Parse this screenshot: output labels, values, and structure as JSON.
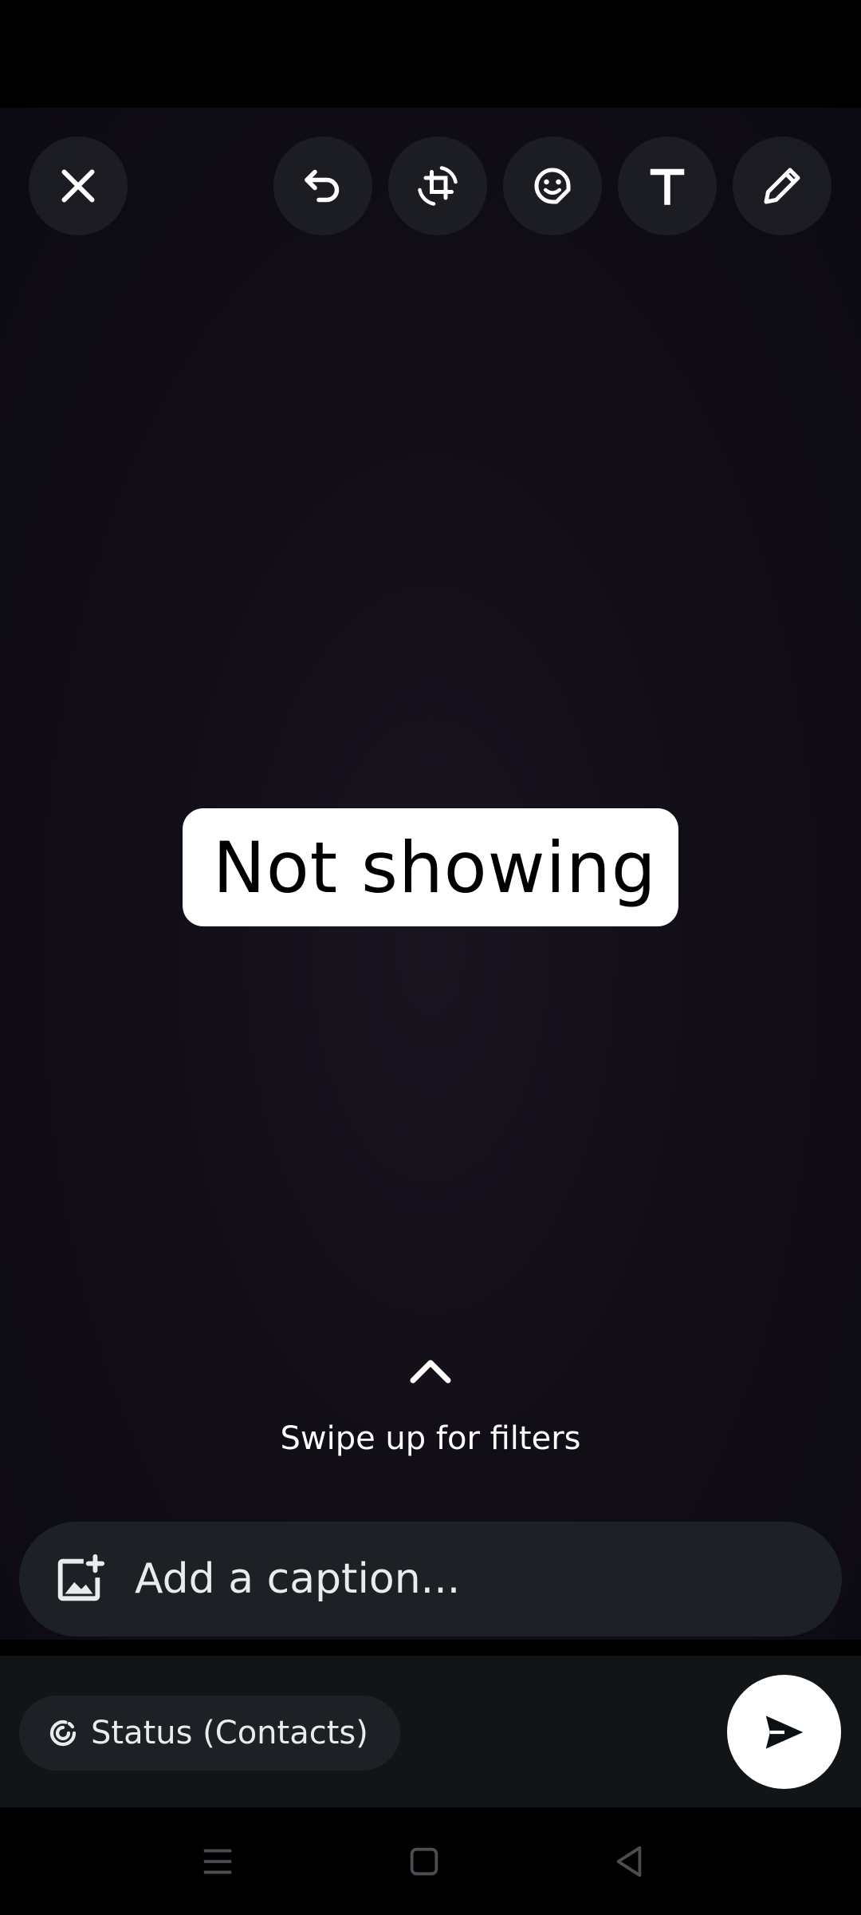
{
  "toolbar": {
    "close_icon": "close-icon",
    "undo_icon": "undo-icon",
    "crop_rotate_icon": "crop-rotate-icon",
    "sticker_icon": "sticker-icon",
    "text_icon": "text-icon",
    "draw_icon": "pencil-icon"
  },
  "canvas": {
    "text_sticker": "Not showing"
  },
  "filters": {
    "hint": "Swipe up for filters"
  },
  "caption": {
    "placeholder": "Add a caption..."
  },
  "footer": {
    "audience": "Status (Contacts)",
    "send_icon": "send-icon"
  },
  "colors": {
    "background": "#000000",
    "caption_bar": "#1d2025",
    "bottom_panel": "#121518",
    "send_button": "#ffffff"
  }
}
